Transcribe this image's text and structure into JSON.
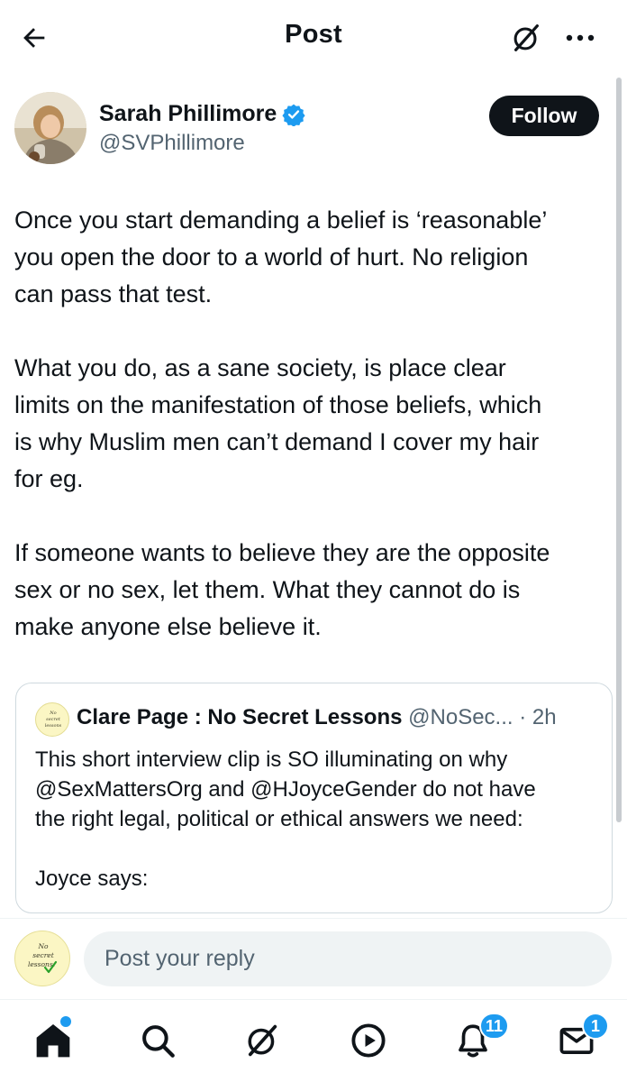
{
  "header": {
    "title": "Post",
    "icons": {
      "back": "arrow-left-icon",
      "grok": "grok-icon",
      "more": "more-icon"
    }
  },
  "author": {
    "name": "Sarah Phillimore",
    "handle": "@SVPhillimore",
    "verified": true,
    "follow_label": "Follow"
  },
  "post": {
    "paragraphs": [
      [
        "Once you start demanding a belief is ‘reasonable’",
        "you open the door to a world of hurt. No religion",
        "can pass that test."
      ],
      [
        "What you do, as a sane society, is place clear",
        "limits on the manifestation of those beliefs, which",
        "is why Muslim men can’t demand I cover my hair",
        "for eg."
      ],
      [
        "If someone wants to believe they are the opposite",
        "sex or no sex, let them. What they cannot do is",
        "make anyone else believe it."
      ]
    ]
  },
  "quote": {
    "name": "Clare Page : No Secret Lessons",
    "handle": "@NoSec...",
    "separator": "·",
    "time": "2h",
    "avatar_text": [
      "No",
      "secret",
      "lessons"
    ],
    "lines": [
      "This short interview clip is SO illuminating on why",
      "@SexMattersOrg and @HJoyceGender do not have",
      "the right legal, political or ethical answers we need:",
      "",
      "Joyce says:"
    ]
  },
  "reply": {
    "placeholder": "Post your reply",
    "avatar_text": [
      "No",
      "secret",
      "lessons."
    ]
  },
  "nav": {
    "items": [
      {
        "name": "home",
        "icon": "home-icon"
      },
      {
        "name": "search",
        "icon": "search-icon"
      },
      {
        "name": "grok",
        "icon": "grok-icon"
      },
      {
        "name": "video",
        "icon": "play-icon"
      },
      {
        "name": "notifications",
        "icon": "bell-icon",
        "badge": "11"
      },
      {
        "name": "messages",
        "icon": "mail-icon",
        "badge": "1"
      }
    ]
  },
  "colors": {
    "accent": "#1d9bf0",
    "text": "#0f1419",
    "muted": "#536471",
    "border": "#cfd9de",
    "input_bg": "#eff3f4"
  }
}
